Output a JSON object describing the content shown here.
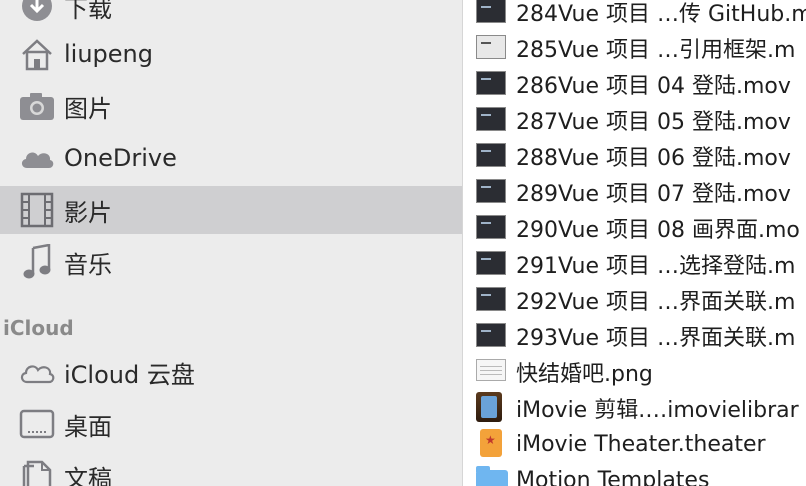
{
  "sidebar": {
    "items": [
      {
        "label": "下载",
        "icon": "download-icon"
      },
      {
        "label": "liupeng",
        "icon": "home-icon"
      },
      {
        "label": "图片",
        "icon": "camera-icon"
      },
      {
        "label": "OneDrive",
        "icon": "cloud-icon"
      },
      {
        "label": "影片",
        "icon": "film-icon",
        "selected": true
      },
      {
        "label": "音乐",
        "icon": "music-note-icon"
      }
    ],
    "icloud_header": "iCloud",
    "icloud_items": [
      {
        "label": "iCloud 云盘",
        "icon": "cloud-icon"
      },
      {
        "label": "桌面",
        "icon": "desktop-icon"
      },
      {
        "label": "文稿",
        "icon": "document-icon"
      }
    ]
  },
  "files": [
    {
      "name": "284Vue 项目 …传 GitHub.m",
      "type": "video"
    },
    {
      "name": "285Vue 项目 …引用框架.m",
      "type": "video-light"
    },
    {
      "name": "286Vue 项目 04 登陆.mov",
      "type": "video"
    },
    {
      "name": "287Vue 项目 05 登陆.mov",
      "type": "video"
    },
    {
      "name": "288Vue 项目 06 登陆.mov",
      "type": "video"
    },
    {
      "name": "289Vue 项目 07 登陆.mov",
      "type": "video"
    },
    {
      "name": "290Vue 项目 08 画界面.mo",
      "type": "video"
    },
    {
      "name": "291Vue 项目 …选择登陆.m",
      "type": "video"
    },
    {
      "name": "292Vue 项目 …界面关联.m",
      "type": "video"
    },
    {
      "name": "293Vue 项目 …界面关联.m",
      "type": "video"
    },
    {
      "name": "快结婚吧.png",
      "type": "png"
    },
    {
      "name": "iMovie 剪辑.…imovielibrar",
      "type": "imovie-library"
    },
    {
      "name": "iMovie Theater.theater",
      "type": "imovie-theater"
    },
    {
      "name": "Motion Templates",
      "type": "folder"
    }
  ]
}
